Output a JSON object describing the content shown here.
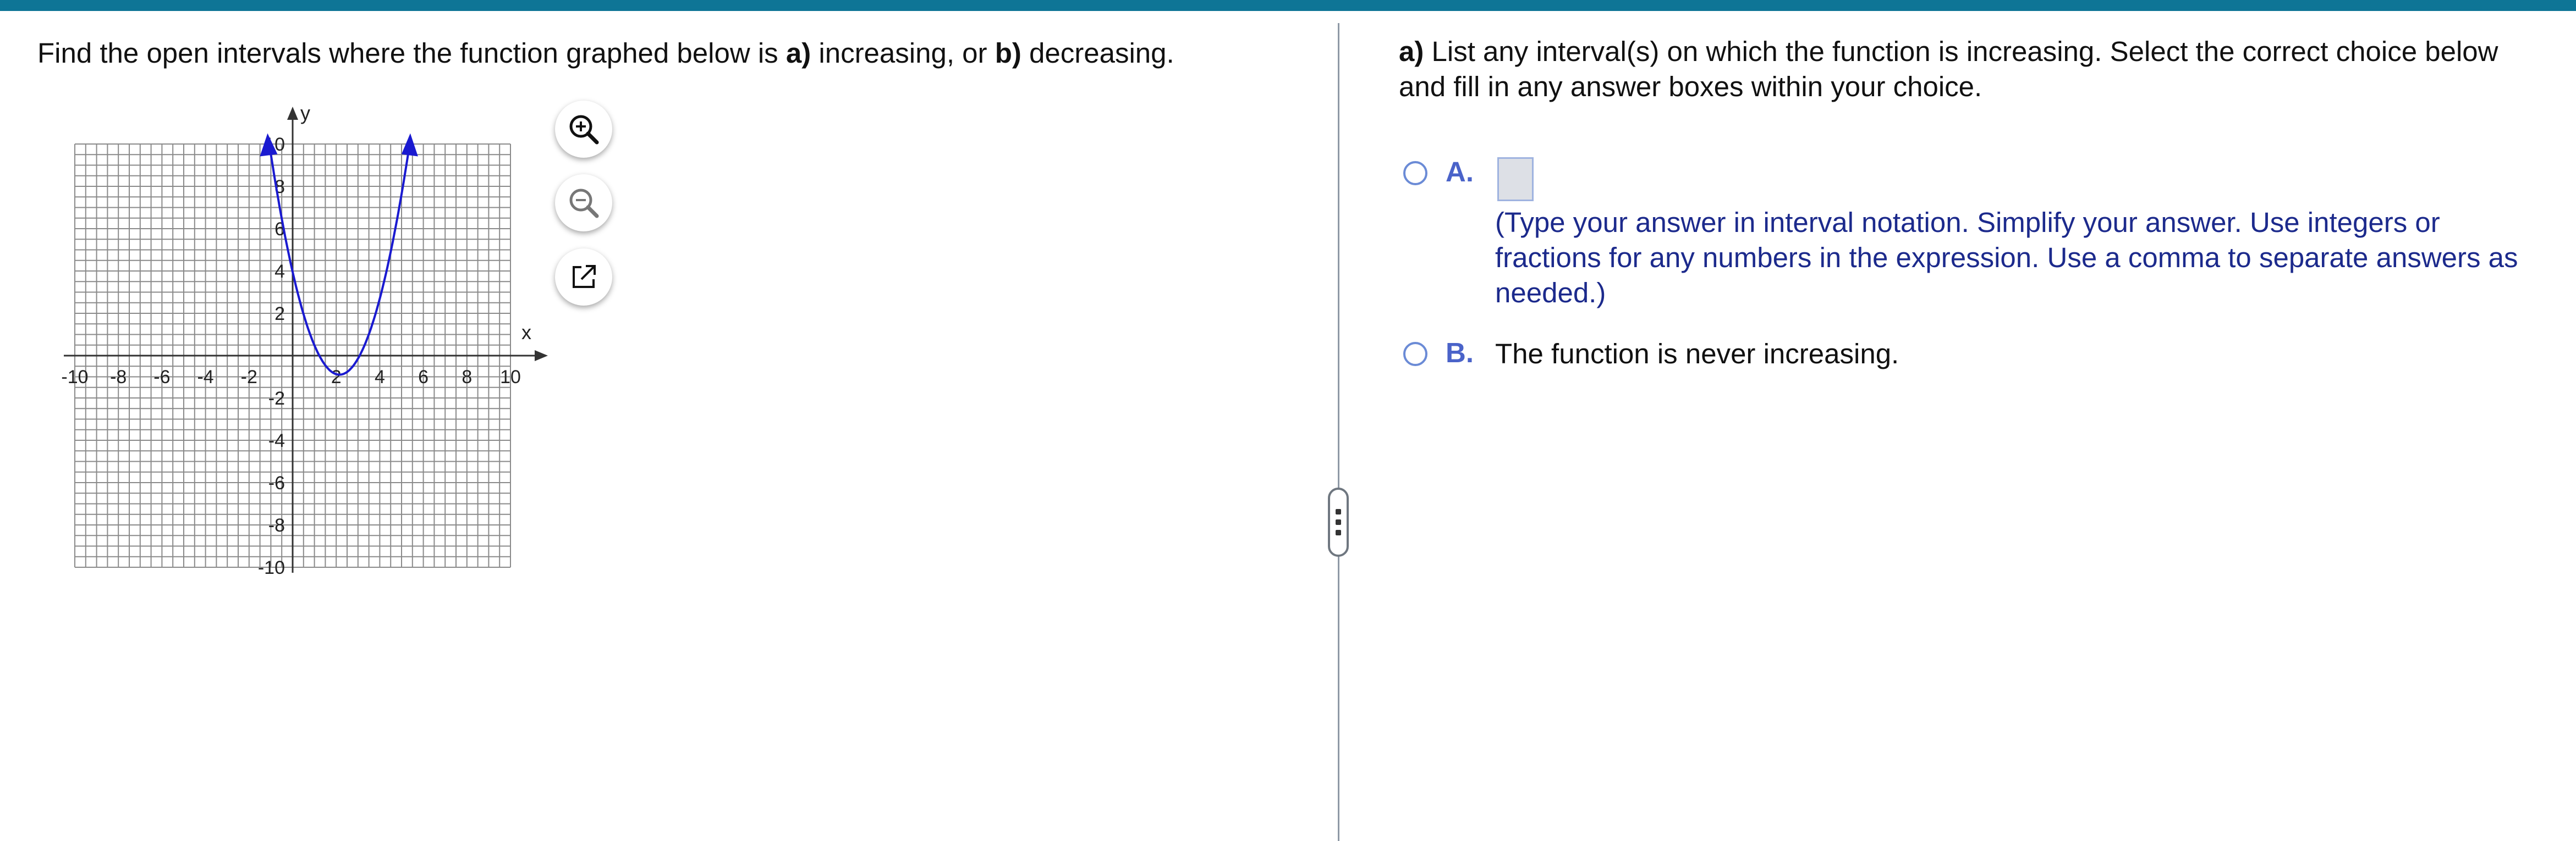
{
  "question": {
    "prefix": "Find the open intervals where the function graphed below is ",
    "part_a_label": "a)",
    "part_a_text": " increasing, or ",
    "part_b_label": "b)",
    "part_b_text": " decreasing."
  },
  "graph": {
    "x_axis_label": "x",
    "y_axis_label": "y",
    "x_tick_labels": [
      "-10",
      "-8",
      "-6",
      "-4",
      "-2",
      "2",
      "4",
      "6",
      "8",
      "10"
    ],
    "y_tick_labels": [
      "10",
      "8",
      "6",
      "4",
      "2",
      "-2",
      "-4",
      "-6",
      "-8",
      "-10"
    ],
    "curve_color": "#1a1ad0",
    "tools": [
      "zoom-in-icon",
      "zoom-out-icon",
      "pop-out-icon"
    ]
  },
  "answer_panel": {
    "prompt_label": "a)",
    "prompt_text": " List any interval(s) on which the function is increasing. Select the correct choice below and fill in any answer boxes within your choice.",
    "choice_a_letter": "A.",
    "choice_a_hint": "(Type your answer in interval notation. Simplify your answer. Use integers or fractions for any numbers in the expression. Use a comma to separate answers as needed.)",
    "choice_a_value": "",
    "choice_b_letter": "B.",
    "choice_b_text": "The function is never increasing."
  },
  "colors": {
    "topbar": "#0e7596",
    "accent": "#4a63c9",
    "hint_text": "#1c2a8c"
  }
}
